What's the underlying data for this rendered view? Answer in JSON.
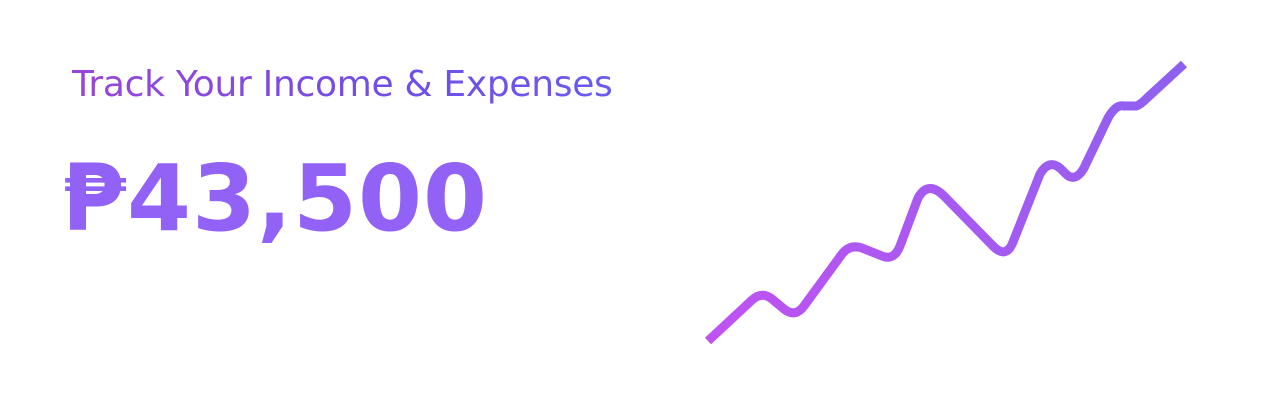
{
  "hero": {
    "headline": "Track Your Income & Expenses",
    "balance": "₱43,500"
  },
  "trend_line": {
    "icon": "trend-line-icon",
    "colors": {
      "start": "#c052f2",
      "end": "#8d61f0"
    }
  }
}
